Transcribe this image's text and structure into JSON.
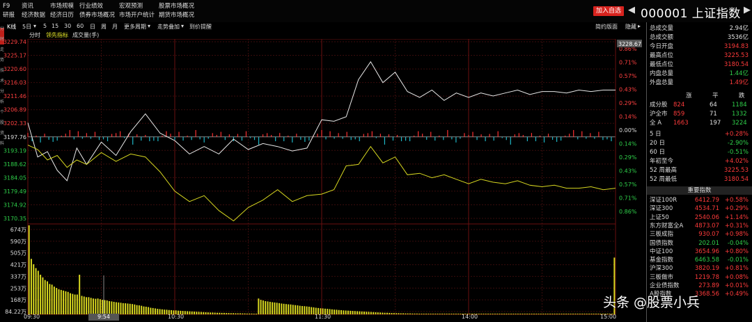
{
  "menu": {
    "col1": [
      "F9",
      "研报"
    ],
    "col2": [
      "资讯",
      "经济数据"
    ],
    "col3": [
      "市场规模",
      "经济日历"
    ],
    "col4": [
      "行业绩效",
      "债券市场概况"
    ],
    "col5": [
      "宏观预测",
      "市场开户统计"
    ],
    "col6": [
      "股票市场概况",
      "期货市场概况"
    ]
  },
  "header": {
    "add_favorite": "加入自选",
    "prev_arrow": "◀",
    "next_arrow": "▶",
    "index_title": "000001 上证指数"
  },
  "toolbar": {
    "items": [
      "K线",
      "5日",
      "▾",
      "5",
      "15",
      "30",
      "60",
      "日",
      "周",
      "月",
      "更多周期",
      "▾",
      "走势叠加",
      "▾",
      "到价提醒"
    ],
    "right": [
      "简约版面",
      "隐藏",
      "▸"
    ]
  },
  "subbar": {
    "items": [
      "分时",
      "领先指标",
      "成交量(手)"
    ]
  },
  "leftstrip": [
    "分",
    "时",
    "走",
    "势",
    "技",
    "术",
    "分",
    "析",
    "个",
    "股",
    "资",
    "料"
  ],
  "chart_data": {
    "type": "line",
    "title": "",
    "price_axis": [
      "3229.74",
      "3225.17",
      "3220.60",
      "3216.03",
      "3211.46",
      "3206.89",
      "3202.33",
      "3197.76",
      "3193.19",
      "3188.62",
      "3184.05",
      "3179.49",
      "3174.92",
      "3170.35"
    ],
    "pct_axis": [
      "0.86%",
      "0.71%",
      "0.57%",
      "0.43%",
      "0.29%",
      "0.14%",
      "0.00%",
      "0.14%",
      "0.29%",
      "0.43%",
      "0.57%",
      "0.71%",
      "0.86%"
    ],
    "volume_axis": [
      "674万",
      "590万",
      "505万",
      "421万",
      "337万",
      "253万",
      "168万",
      "84.22万"
    ],
    "time_labels": [
      "09:30",
      "10:30",
      "11:30",
      "14:00",
      "15:00"
    ],
    "cursor_time": "9:54",
    "cursor_price": "3228.67",
    "prev_close": 3197.76,
    "series": [
      {
        "name": "",
        "color": "#e8e8e8",
        "t": [
          0,
          4,
          8,
          12,
          16,
          20,
          24,
          30,
          36,
          42,
          48,
          54,
          60,
          66,
          72,
          78,
          84,
          90,
          96,
          102,
          108,
          114,
          120,
          125,
          130,
          135,
          140,
          145,
          150,
          155,
          160,
          165,
          170,
          175,
          180,
          185,
          190,
          195,
          200,
          205,
          210,
          215,
          220,
          225,
          230,
          235,
          240
        ],
        "values": [
          3202.5,
          3191.0,
          3192.8,
          3186.5,
          3183.0,
          3194.0,
          3188.5,
          3196.0,
          3191.5,
          3199.5,
          3205.5,
          3199.0,
          3196.5,
          3192.0,
          3194.5,
          3192.0,
          3197.0,
          3193.5,
          3195.5,
          3194.5,
          3193.0,
          3194.0,
          3203.5,
          3203.0,
          3204.5,
          3217.0,
          3223.0,
          3216.0,
          3219.5,
          3213.0,
          3211.0,
          3213.5,
          3210.0,
          3212.5,
          3211.0,
          3212.5,
          3211.5,
          3212.5,
          3213.5,
          3212.0,
          3213.0,
          3213.0,
          3212.5,
          3213.5,
          3213.0,
          3213.5,
          3213.5
        ]
      },
      {
        "name": "",
        "color": "#d8d820",
        "t": [
          0,
          4,
          8,
          12,
          16,
          20,
          24,
          30,
          36,
          42,
          48,
          54,
          60,
          66,
          72,
          78,
          84,
          90,
          96,
          102,
          108,
          114,
          120,
          125,
          130,
          135,
          140,
          145,
          150,
          155,
          160,
          165,
          170,
          175,
          180,
          185,
          190,
          195,
          200,
          205,
          210,
          215,
          220,
          225,
          230,
          235,
          240
        ],
        "values": [
          3195.0,
          3193.5,
          3190.0,
          3191.5,
          3187.5,
          3190.0,
          3188.5,
          3192.5,
          3189.5,
          3192.0,
          3191.0,
          3186.0,
          3179.5,
          3176.0,
          3178.0,
          3173.0,
          3169.5,
          3174.0,
          3176.5,
          3180.0,
          3176.0,
          3178.0,
          3178.5,
          3180.0,
          3188.0,
          3188.5,
          3194.5,
          3189.0,
          3191.0,
          3185.0,
          3185.5,
          3184.0,
          3185.0,
          3183.5,
          3182.0,
          3183.5,
          3182.5,
          3182.0,
          3183.0,
          3181.5,
          3181.0,
          3181.5,
          3180.5,
          3180.5,
          3181.0,
          3180.0,
          3180.5
        ]
      }
    ],
    "volume_wan": [
      674,
      420,
      380,
      350,
      330,
      300,
      280,
      260,
      250,
      230,
      225,
      210,
      200,
      190,
      185,
      180,
      175,
      170,
      160,
      155,
      150,
      150,
      300,
      140,
      135,
      130,
      130,
      125,
      120,
      118,
      120,
      115,
      110,
      108,
      105,
      100,
      98,
      95,
      92,
      90,
      88,
      85,
      84,
      82,
      80,
      78,
      75,
      70,
      68,
      65,
      60,
      58,
      55,
      50,
      48,
      45,
      42,
      40,
      38,
      36,
      35,
      33,
      32,
      30,
      30,
      28,
      27,
      26,
      25,
      24,
      23,
      22,
      21,
      20,
      19,
      18,
      17,
      16,
      15,
      14,
      14,
      13,
      12,
      12,
      11,
      11,
      10,
      10,
      9,
      9,
      8,
      8,
      8,
      7,
      7,
      6,
      6,
      6,
      5,
      5,
      120,
      110,
      105,
      100,
      98,
      95,
      92,
      90,
      88,
      85,
      82,
      80,
      78,
      76,
      75,
      72,
      70,
      68,
      65,
      63,
      62,
      60,
      58,
      55,
      53,
      50,
      48,
      46,
      45,
      43,
      42,
      40,
      38,
      36,
      35,
      33,
      32,
      30,
      29,
      28,
      27,
      26,
      25,
      24,
      23,
      22,
      21,
      20,
      19,
      18,
      17,
      16,
      15,
      14,
      13,
      12,
      12,
      11,
      10,
      10,
      9,
      9,
      8,
      8,
      7,
      7,
      7,
      6,
      6,
      6,
      5,
      5,
      5,
      4,
      4,
      4,
      4,
      3,
      3,
      3,
      3,
      3,
      2,
      2,
      2,
      2,
      2,
      2,
      2,
      2,
      2,
      2,
      2,
      2,
      2,
      2,
      2,
      2,
      2,
      2,
      2,
      2,
      2,
      2,
      2,
      2,
      2,
      2,
      2,
      2,
      2,
      2,
      2,
      2,
      2,
      2,
      2,
      2,
      2,
      2,
      2,
      2,
      2,
      2,
      2,
      2,
      2,
      2,
      2,
      2,
      2,
      2,
      2,
      2,
      2,
      2,
      2,
      2,
      2,
      2,
      2,
      2,
      2,
      2,
      2,
      2,
      2,
      2,
      2,
      2,
      2,
      2,
      2,
      2,
      2,
      430
    ]
  },
  "right_panel": {
    "stats": [
      {
        "k": "总成交量",
        "v": "2.94亿",
        "c": "white"
      },
      {
        "k": "总成交额",
        "v": "3536亿",
        "c": "white"
      },
      {
        "k": "今日开盘",
        "v": "3194.83",
        "c": "red"
      },
      {
        "k": "最高点位",
        "v": "3225.53",
        "c": "red"
      },
      {
        "k": "最低点位",
        "v": "3180.54",
        "c": "red"
      },
      {
        "k": "内盘总量",
        "v": "1.44亿",
        "c": "green"
      },
      {
        "k": "外盘总量",
        "v": "1.49亿",
        "c": "red"
      }
    ],
    "breadth_header": [
      "涨",
      "平",
      "跌"
    ],
    "breadth": [
      {
        "k": "成分股",
        "up": "824",
        "flat": "64",
        "down": "1184"
      },
      {
        "k": "沪全市",
        "up": "859",
        "flat": "71",
        "down": "1332"
      },
      {
        "k": "全 A",
        "up": "1663",
        "flat": "197",
        "down": "3224"
      }
    ],
    "periods": [
      {
        "k": "5 日",
        "v": "+0.28%",
        "c": "red"
      },
      {
        "k": "20 日",
        "v": "-2.90%",
        "c": "green"
      },
      {
        "k": "60 日",
        "v": "-0.51%",
        "c": "green"
      },
      {
        "k": "年初至今",
        "v": "+4.02%",
        "c": "red"
      },
      {
        "k": "52 周最高",
        "v": "3225.53",
        "c": "red"
      },
      {
        "k": "52 周最低",
        "v": "3180.54",
        "c": "red"
      }
    ],
    "indices_header": "重要指数",
    "indices": [
      {
        "k": "深证100R",
        "p": "6412.79",
        "c1": "red",
        "v": "+0.58%",
        "c2": "red"
      },
      {
        "k": "深证300",
        "p": "4534.71",
        "c1": "red",
        "v": "+0.29%",
        "c2": "red"
      },
      {
        "k": "上证50",
        "p": "2540.06",
        "c1": "red",
        "v": "+1.14%",
        "c2": "red"
      },
      {
        "k": "东方财富全A",
        "p": "4873.07",
        "c1": "red",
        "v": "+0.31%",
        "c2": "red"
      },
      {
        "k": "三板成指",
        "p": "930.07",
        "c1": "red",
        "v": "+0.98%",
        "c2": "red"
      },
      {
        "k": "国债指数",
        "p": "202.01",
        "c1": "green",
        "v": "-0.04%",
        "c2": "green"
      },
      {
        "k": "中证100",
        "p": "3654.96",
        "c1": "red",
        "v": "+0.80%",
        "c2": "red"
      },
      {
        "k": "基金指数",
        "p": "6463.58",
        "c1": "green",
        "v": "-0.01%",
        "c2": "green"
      },
      {
        "k": "沪深300",
        "p": "3820.19",
        "c1": "red",
        "v": "+0.81%",
        "c2": "red"
      },
      {
        "k": "三板做市",
        "p": "1219.78",
        "c1": "red",
        "v": "+0.08%",
        "c2": "red"
      },
      {
        "k": "企业债指数",
        "p": "273.89",
        "c1": "red",
        "v": "+0.01%",
        "c2": "red"
      },
      {
        "k": "A股指数",
        "p": "3368.56",
        "c1": "red",
        "v": "+0.49%",
        "c2": "red"
      }
    ]
  },
  "watermark": "头条 @股票小兵"
}
